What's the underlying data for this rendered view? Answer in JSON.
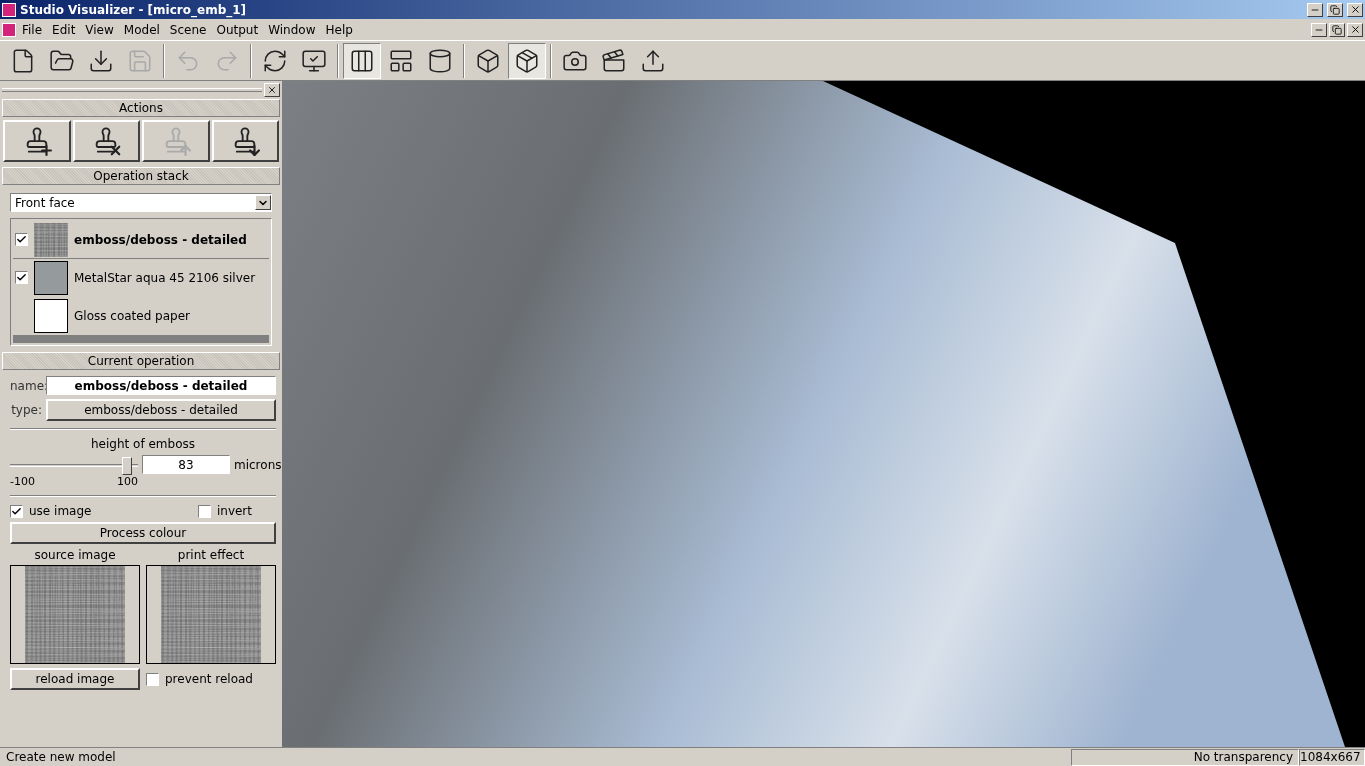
{
  "window": {
    "title": "Studio Visualizer - [micro_emb_1]"
  },
  "menu": [
    "File",
    "Edit",
    "View",
    "Model",
    "Scene",
    "Output",
    "Window",
    "Help"
  ],
  "toolbar": [
    {
      "kind": "new",
      "disabled": false,
      "selected": false
    },
    {
      "kind": "open",
      "disabled": false,
      "selected": false
    },
    {
      "kind": "import",
      "disabled": false,
      "selected": false
    },
    {
      "kind": "save",
      "disabled": true,
      "selected": false
    },
    {
      "kind": "sep"
    },
    {
      "kind": "undo",
      "disabled": true,
      "selected": false
    },
    {
      "kind": "redo",
      "disabled": true,
      "selected": false
    },
    {
      "kind": "sep"
    },
    {
      "kind": "refresh",
      "disabled": false,
      "selected": false
    },
    {
      "kind": "display",
      "disabled": false,
      "selected": false
    },
    {
      "kind": "sep"
    },
    {
      "kind": "flat",
      "disabled": false,
      "selected": true
    },
    {
      "kind": "folded",
      "disabled": false,
      "selected": false
    },
    {
      "kind": "cylinder",
      "disabled": false,
      "selected": false
    },
    {
      "kind": "sep"
    },
    {
      "kind": "cube",
      "disabled": false,
      "selected": false
    },
    {
      "kind": "box",
      "disabled": false,
      "selected": true
    },
    {
      "kind": "sep"
    },
    {
      "kind": "camera",
      "disabled": false,
      "selected": false
    },
    {
      "kind": "clapper",
      "disabled": false,
      "selected": false
    },
    {
      "kind": "export",
      "disabled": false,
      "selected": false
    }
  ],
  "panel": {
    "actions_title": "Actions",
    "actions": [
      {
        "kind": "add",
        "disabled": false
      },
      {
        "kind": "remove",
        "disabled": false
      },
      {
        "kind": "up",
        "disabled": true
      },
      {
        "kind": "down",
        "disabled": false
      }
    ],
    "stack_title": "Operation stack",
    "face": "Front face",
    "stack": [
      {
        "kind": "layer",
        "label": "emboss/deboss - detailed",
        "checked": true,
        "selected": true,
        "textured": true
      },
      {
        "kind": "layer",
        "label": "MetalStar aqua 45 2106 silver",
        "checked": true,
        "selected": false,
        "textured": false,
        "color": "#959a9d"
      },
      {
        "kind": "base",
        "label": "Gloss coated paper",
        "selected": false,
        "textured": false,
        "color": "#ffffff"
      }
    ],
    "current_title": "Current operation",
    "name_label": "name:",
    "name_value": "emboss/deboss - detailed",
    "type_label": "type:",
    "type_value": "emboss/deboss - detailed",
    "slider_title": "height of emboss",
    "slider_min": "-100",
    "slider_max": "100",
    "level": 0.915,
    "value": "83",
    "unit": "microns",
    "use_image": {
      "label": "use image",
      "checked": true
    },
    "invert": {
      "label": "invert",
      "checked": false
    },
    "process_button": "Process colour",
    "source_label": "source image",
    "effect_label": "print effect",
    "reload_button": "reload image",
    "prevent_reload": {
      "label": "prevent reload",
      "checked": false
    }
  },
  "status_bar": {
    "message": "Create new model",
    "transparency": "No transparency",
    "size": "1084x667"
  }
}
